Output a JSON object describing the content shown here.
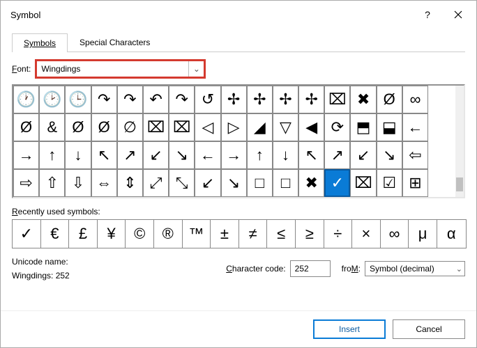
{
  "window": {
    "title": "Symbol"
  },
  "tabs": {
    "symbols": "Symbols",
    "special": "Special Characters"
  },
  "font": {
    "label_prefix": "F",
    "label_rest": "ont:",
    "value": "Wingdings"
  },
  "grid": {
    "rows": [
      [
        "🕐",
        "🕑",
        "🕒",
        "↷",
        "↷",
        "↶",
        "↷",
        "↺",
        "✢",
        "✢",
        "✢",
        "✢",
        "⌧",
        "✖",
        "Ø",
        "∞"
      ],
      [
        "Ø",
        "&",
        "Ø",
        "Ø",
        "∅",
        "⌧",
        "⌧",
        "◁",
        "▷",
        "◢",
        "▽",
        "◀",
        "⟳",
        "⬒",
        "⬓",
        "←"
      ],
      [
        "→",
        "↑",
        "↓",
        "↖",
        "↗",
        "↙",
        "↘",
        "←",
        "→",
        "↑",
        "↓",
        "↖",
        "↗",
        "↙",
        "↘",
        "⇦"
      ],
      [
        "⇨",
        "⇧",
        "⇩",
        "⇔",
        "⇕",
        "⤢",
        "⤡",
        "↙",
        "↘",
        "□",
        "□",
        "✖",
        "✓",
        "⌧",
        "☑",
        "⊞"
      ]
    ],
    "selected": {
      "row": 3,
      "col": 12
    }
  },
  "recent": {
    "label_prefix": "R",
    "label_rest": "ecently used symbols:",
    "items": [
      "✓",
      "€",
      "£",
      "¥",
      "©",
      "®",
      "™",
      "±",
      "≠",
      "≤",
      "≥",
      "÷",
      "×",
      "∞",
      "μ",
      "α"
    ]
  },
  "info": {
    "unicode_label": "Unicode name:",
    "unicode_value": "Wingdings: 252",
    "charcode_label_u": "C",
    "charcode_label_rest": "haracter code:",
    "charcode_value": "252",
    "from_label_u": "M",
    "from_label_prefix": "fro",
    "from_label_suffix": ":",
    "from_value": "Symbol (decimal)"
  },
  "buttons": {
    "insert": "Insert",
    "cancel": "Cancel"
  }
}
